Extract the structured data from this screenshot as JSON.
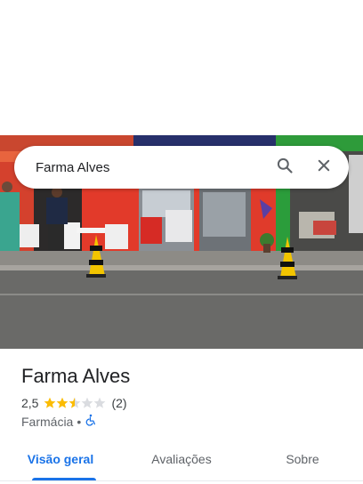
{
  "search": {
    "query": "Farma Alves",
    "search_icon": "search-icon",
    "close_icon": "close-icon"
  },
  "photo": {
    "subject": "storefront-photo"
  },
  "place": {
    "name": "Farma Alves",
    "rating": "2,5",
    "stars_filled": 2.5,
    "stars_total": 5,
    "review_count": "(2)",
    "category": "Farmácia",
    "separator": "•",
    "accessibility_icon": "wheelchair-icon"
  },
  "tabs": [
    {
      "label": "Visão geral",
      "active": true
    },
    {
      "label": "Avaliações",
      "active": false
    },
    {
      "label": "Sobre",
      "active": false
    }
  ],
  "colors": {
    "accent": "#1a73e8",
    "star": "#fbbc04",
    "star_empty": "#dadce0"
  }
}
